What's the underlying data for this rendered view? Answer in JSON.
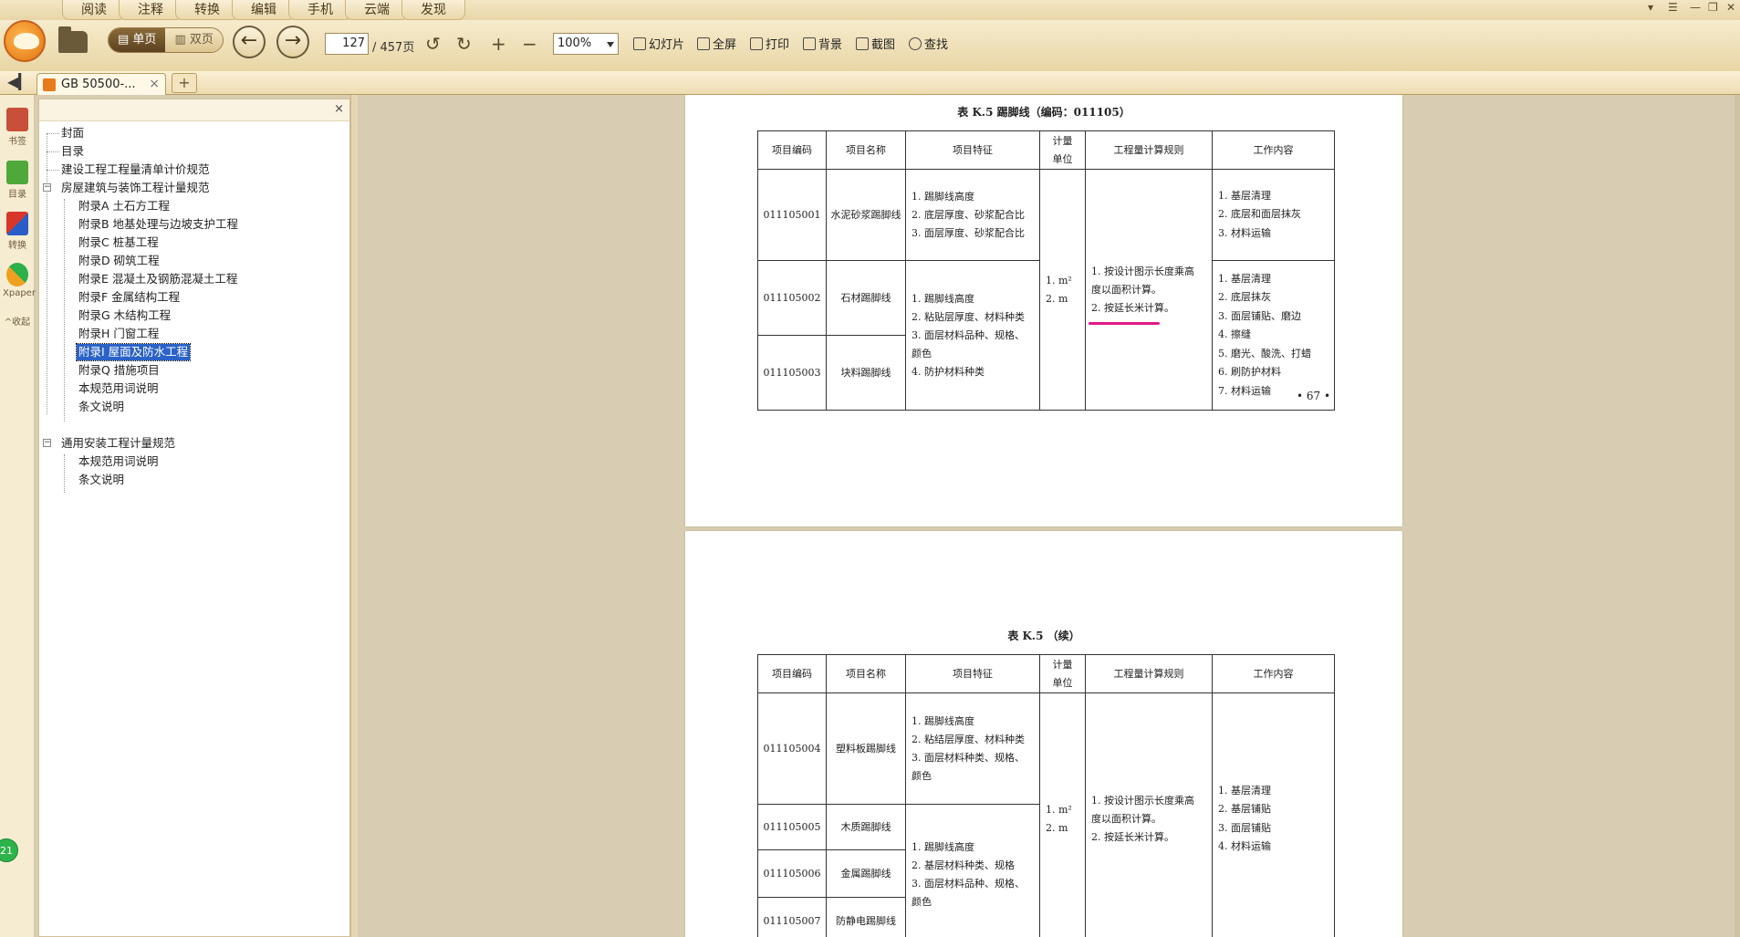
{
  "menubar": {
    "items": [
      "阅读",
      "注释",
      "转换",
      "编辑",
      "手机",
      "云端",
      "发现"
    ],
    "window_controls": [
      "▾",
      "☰",
      "—",
      "❐",
      "✕"
    ]
  },
  "toolbar": {
    "single_page": "单页",
    "double_page": "双页",
    "current_page": "127",
    "total_pages": "/ 457页",
    "zoom": "100%",
    "slideshow": "幻灯片",
    "fullscreen": "全屏",
    "print": "打印",
    "background": "背景",
    "screenshot": "截图",
    "find": "查找"
  },
  "tabs": {
    "doc_title": "GB 50500-...",
    "close": "×",
    "add": "+"
  },
  "rail": {
    "items": [
      "书签",
      "目录",
      "转换",
      "Xpaper"
    ],
    "collapse": "^收起",
    "badge": "21"
  },
  "outline": {
    "close": "×",
    "nodes": [
      {
        "label": "封面"
      },
      {
        "label": "目录"
      },
      {
        "label": "建设工程工程量清单计价规范"
      },
      {
        "label": "房屋建筑与装饰工程计量规范"
      },
      {
        "label": "附录A 土石方工程"
      },
      {
        "label": "附录B 地基处理与边坡支护工程"
      },
      {
        "label": "附录C 桩基工程"
      },
      {
        "label": "附录D 砌筑工程"
      },
      {
        "label": "附录E 混凝土及钢筋混凝土工程"
      },
      {
        "label": "附录F 金属结构工程"
      },
      {
        "label": "附录G 木结构工程"
      },
      {
        "label": "附录H 门窗工程"
      },
      {
        "label": "附录I 屋面及防水工程"
      },
      {
        "label": "附录Q 措施项目"
      },
      {
        "label": "本规范用词说明"
      },
      {
        "label": "条文说明"
      },
      {
        "label": "通用安装工程计量规范"
      },
      {
        "label": "本规范用词说明"
      },
      {
        "label": "条文说明"
      }
    ]
  },
  "document": {
    "page1": {
      "title": "表 K.5 踢脚线（编码：011105）",
      "headers": [
        "项目编码",
        "项目名称",
        "项目特征",
        "计量单位",
        "工程量计算规则",
        "工作内容"
      ],
      "rows": [
        {
          "code": "011105001",
          "name": "水泥砂浆踢脚线",
          "features": [
            "1. 踢脚线高度",
            "2. 底层厚度、砂浆配合比",
            "3. 面层厚度、砂浆配合比"
          ],
          "work": [
            "1. 基层清理",
            "2. 底层和面层抹灰",
            "3. 材料运输"
          ]
        },
        {
          "code": "011105002",
          "name": "石材踢脚线"
        },
        {
          "code": "011105003",
          "name": "块料踢脚线"
        }
      ],
      "shared_features": [
        "1. 踢脚线高度",
        "2. 粘贴层厚度、材料种类",
        "3. 面层材料品种、规格、",
        "颜色",
        "4. 防护材料种类"
      ],
      "shared_work": [
        "1. 基层清理",
        "2. 底层抹灰",
        "3. 面层铺贴、磨边",
        "4. 擦缝",
        "5. 磨光、酸洗、打蜡",
        "6. 刷防护材料",
        "7. 材料运输"
      ],
      "units": [
        "1. m²",
        "2. m"
      ],
      "rule": [
        "1. 按设计图示长度乘高",
        "度以面积计算。",
        "2. 按延长米计算。"
      ],
      "page_number": "• 67 •"
    },
    "page2": {
      "title": "表 K.5 （续）",
      "headers": [
        "项目编码",
        "项目名称",
        "项目特征",
        "计量单位",
        "工程量计算规则",
        "工作内容"
      ],
      "rows": [
        {
          "code": "011105004",
          "name": "塑料板踢脚线",
          "features": [
            "1. 踢脚线高度",
            "2. 粘结层厚度、材料种类",
            "3. 面层材料种类、规格、",
            "颜色"
          ]
        },
        {
          "code": "011105005",
          "name": "木质踢脚线"
        },
        {
          "code": "011105006",
          "name": "金属踢脚线"
        },
        {
          "code": "011105007",
          "name": "防静电踢脚线"
        }
      ],
      "shared_features": [
        "1. 踢脚线高度",
        "2. 基层材料种类、规格",
        "3. 面层材料品种、规格、",
        "颜色"
      ],
      "units": [
        "1. m²",
        "2. m"
      ],
      "rule": [
        "1. 按设计图示长度乘高",
        "度以面积计算。",
        "2. 按延长米计算。"
      ],
      "work": [
        "1. 基层清理",
        "2. 基层铺贴",
        "3. 面层铺贴",
        "4. 材料运输"
      ]
    }
  },
  "colors": {
    "accent": "#e07416",
    "selection": "#2a62c8",
    "annotation_underline": "#e0188a",
    "badge": "#2db34a"
  }
}
